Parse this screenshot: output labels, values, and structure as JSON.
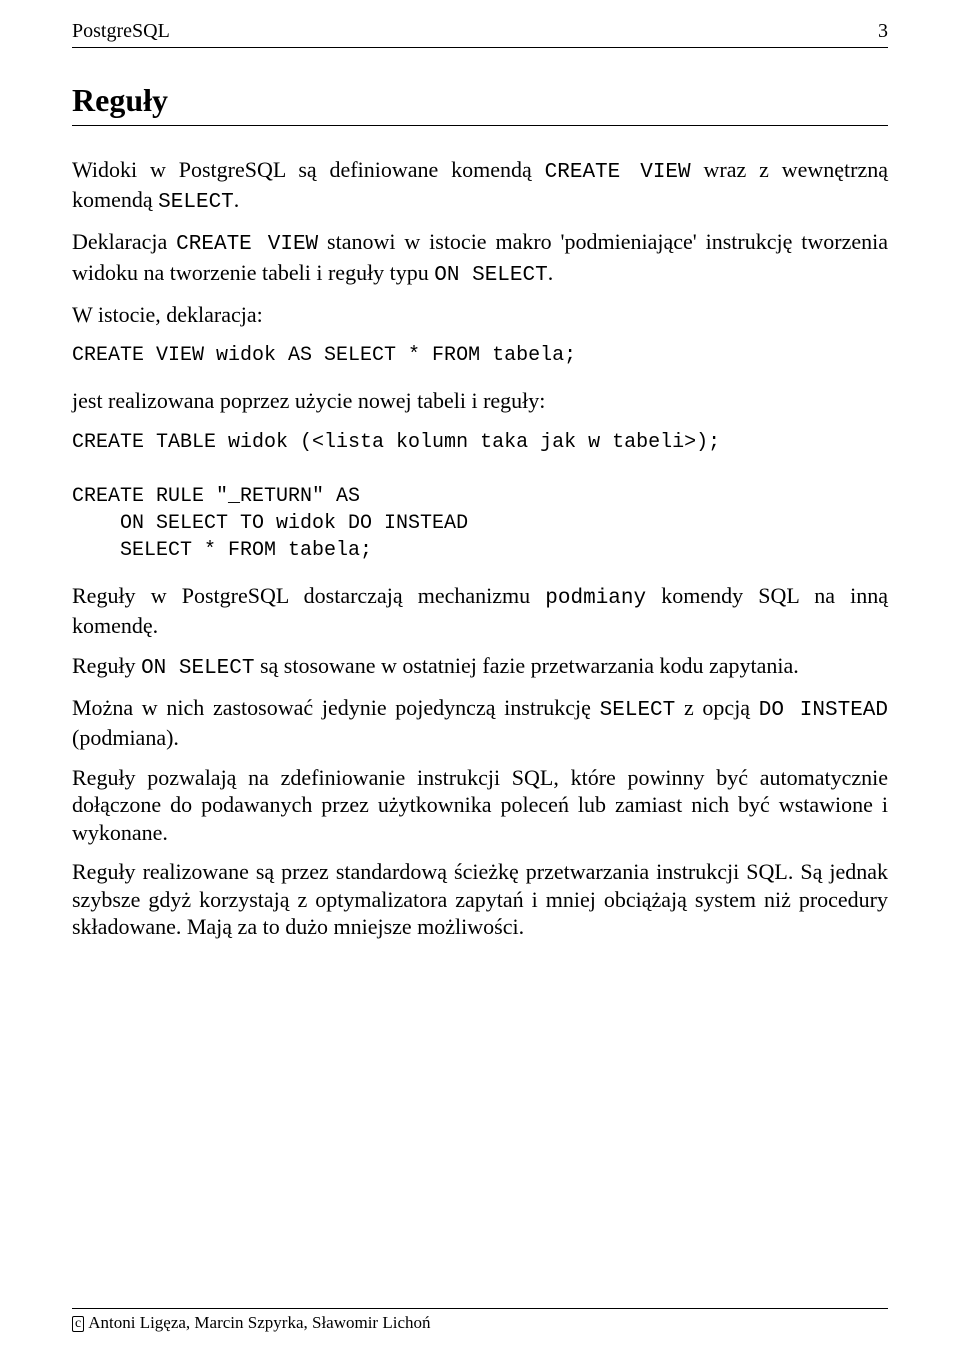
{
  "header": {
    "left": "PostgreSQL",
    "right": "3"
  },
  "section_title": "Reguły",
  "para1_pre": "Widoki w PostgreSQL są definiowane komendą ",
  "kw1": "CREATE VIEW",
  "para1_mid": " wraz z wewnętrzną komendą ",
  "kw2": "SELECT",
  "para1_post": ".",
  "para2_pre": "Deklaracja ",
  "kw3": "CREATE VIEW",
  "para2_mid": " stanowi w istocie makro 'podmieniające' instrukcję tworzenia widoku na tworzenie tabeli i reguły typu ",
  "kw4": "ON SELECT",
  "para2_post": ".",
  "para3": "W istocie, deklaracja:",
  "code1": "CREATE VIEW widok AS SELECT * FROM tabela;",
  "para4": "jest realizowana poprzez użycie nowej tabeli i reguły:",
  "code2": "CREATE TABLE widok (<lista kolumn taka jak w tabeli>);\n\nCREATE RULE \"_RETURN\" AS\n    ON SELECT TO widok DO INSTEAD\n    SELECT * FROM tabela;",
  "para5_pre": "Reguły w PostgreSQL dostarczają mechanizmu ",
  "kw5": "podmiany",
  "para5_post": " komendy SQL na inną komendę.",
  "para6_pre": "Reguły ",
  "kw6": "ON SELECT",
  "para6_post": " są stosowane w ostatniej fazie przetwarzania kodu zapytania.",
  "para7_pre": "Można w nich zastosować jedynie pojedynczą instrukcję ",
  "kw7": "SELECT",
  "para7_mid": " z opcją ",
  "kw8": "DO INSTEAD",
  "para7_post": " (podmiana).",
  "para8": "Reguły pozwalają na zdefiniowanie instrukcji SQL, które powinny być automatycznie dołączone do podawanych przez użytkownika poleceń lub zamiast nich być wstawione i wykonane.",
  "para9": "Reguły realizowane są przez standardową ścieżkę przetwarzania instrukcji SQL. Są jednak szybsze gdyż korzystają z optymalizatora zapytań i mniej obciążają system niż procedury składowane. Mają za to dużo mniejsze możliwości.",
  "footer": {
    "c": "c",
    "text": "Antoni Ligęza, Marcin Szpyrka, Sławomir Lichoń"
  }
}
